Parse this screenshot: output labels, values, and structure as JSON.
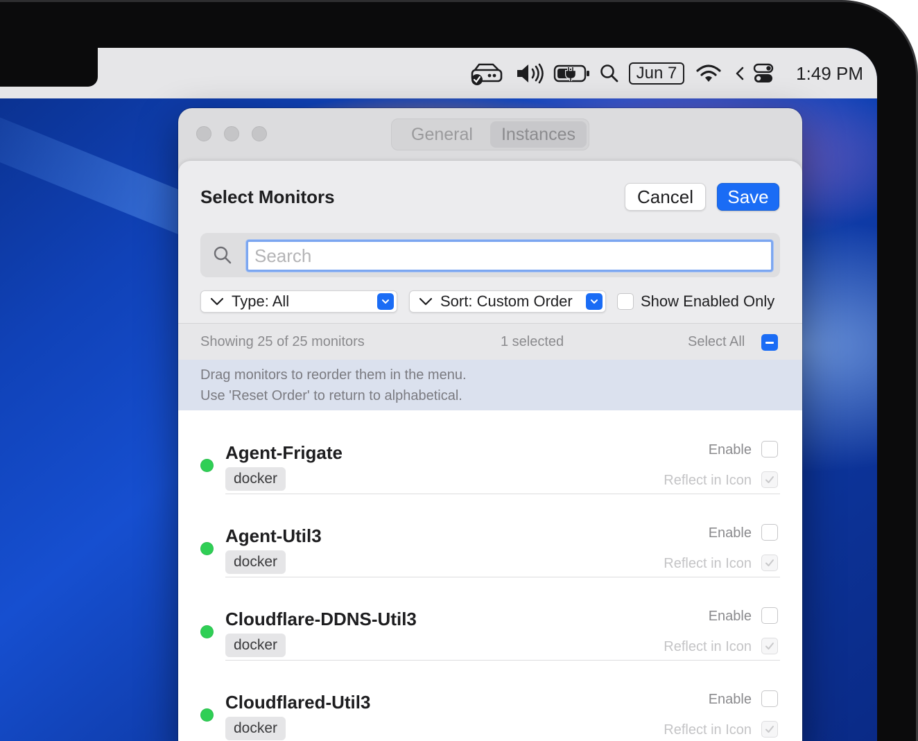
{
  "menubar": {
    "date": "Jun 7",
    "clock": "1:49 PM",
    "icons": [
      "monitor-status-icon",
      "volume-icon",
      "battery-charging-icon",
      "spotlight-search-icon",
      "wifi-icon",
      "chevron-left-icon",
      "control-center-icon"
    ]
  },
  "window": {
    "tabs": [
      {
        "label": "General",
        "active": false
      },
      {
        "label": "Instances",
        "active": true
      }
    ]
  },
  "sheet": {
    "title": "Select Monitors",
    "cancel_label": "Cancel",
    "save_label": "Save",
    "search": {
      "placeholder": "Search",
      "value": ""
    },
    "type_filter": "Type: All",
    "sort_filter": "Sort: Custom Order",
    "show_enabled_label": "Show Enabled Only",
    "show_enabled_checked": false,
    "status": {
      "showing": "Showing 25 of 25 monitors",
      "selected": "1 selected",
      "select_all_label": "Select All"
    },
    "info": {
      "line1": "Drag monitors to reorder them in the menu.",
      "line2": "Use 'Reset Order' to return to alphabetical."
    },
    "enable_label": "Enable",
    "reflect_label": "Reflect in Icon",
    "monitors": [
      {
        "name": "Agent-Frigate",
        "type": "docker",
        "status_color": "#2fcf55",
        "enabled": false,
        "reflect": true
      },
      {
        "name": "Agent-Util3",
        "type": "docker",
        "status_color": "#2fcf55",
        "enabled": false,
        "reflect": true
      },
      {
        "name": "Cloudflare-DDNS-Util3",
        "type": "docker",
        "status_color": "#2fcf55",
        "enabled": false,
        "reflect": true
      },
      {
        "name": "Cloudflared-Util3",
        "type": "docker",
        "status_color": "#2fcf55",
        "enabled": false,
        "reflect": true
      }
    ]
  },
  "colors": {
    "accent": "#1a6cf5",
    "status_up": "#2fcf55"
  }
}
